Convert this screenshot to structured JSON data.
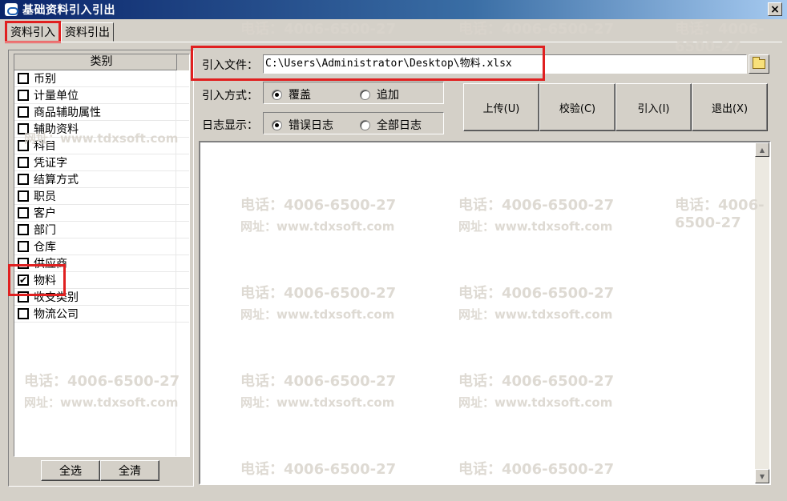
{
  "window": {
    "title": "基础资料引入引出",
    "close_glyph": "×"
  },
  "tabs": [
    {
      "label": "资料引入",
      "active": true
    },
    {
      "label": "资料引出",
      "active": false
    }
  ],
  "category_list": {
    "header": "类别",
    "items": [
      {
        "label": "币别",
        "checked": false
      },
      {
        "label": "计量单位",
        "checked": false
      },
      {
        "label": "商品辅助属性",
        "checked": false
      },
      {
        "label": "辅助资料",
        "checked": false
      },
      {
        "label": "科目",
        "checked": false
      },
      {
        "label": "凭证字",
        "checked": false
      },
      {
        "label": "结算方式",
        "checked": false
      },
      {
        "label": "职员",
        "checked": false
      },
      {
        "label": "客户",
        "checked": false
      },
      {
        "label": "部门",
        "checked": false
      },
      {
        "label": "仓库",
        "checked": false
      },
      {
        "label": "供应商",
        "checked": false
      },
      {
        "label": "物料",
        "checked": true
      },
      {
        "label": "收支类别",
        "checked": false
      },
      {
        "label": "物流公司",
        "checked": false
      }
    ],
    "select_all_label": "全选",
    "clear_all_label": "全清"
  },
  "import_file": {
    "label": "引入文件：",
    "value": "C:\\Users\\Administrator\\Desktop\\物料.xlsx"
  },
  "import_mode": {
    "label": "引入方式：",
    "options": [
      {
        "label": "覆盖",
        "selected": true
      },
      {
        "label": "追加",
        "selected": false
      }
    ]
  },
  "log_display": {
    "label": "日志显示：",
    "options": [
      {
        "label": "错误日志",
        "selected": true
      },
      {
        "label": "全部日志",
        "selected": false
      }
    ]
  },
  "actions": {
    "upload": "上传(U)",
    "verify": "校验(C)",
    "import": "引入(I)",
    "exit": "退出(X)"
  },
  "watermark": {
    "phone": "电话：4006-6500-27",
    "site": "网址：www.tdxsoft.com"
  },
  "colors": {
    "highlight": "#e02020",
    "titlebar_start": "#0a246a",
    "titlebar_end": "#a6caf0"
  }
}
